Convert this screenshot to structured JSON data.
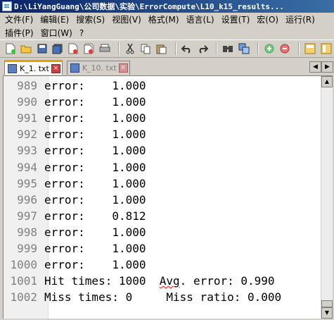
{
  "window": {
    "title": "D:\\LiYangGuang\\公司数据\\实验\\ErrorCompute\\L10_k15_results..."
  },
  "menu": {
    "row1": [
      "文件(F)",
      "编辑(E)",
      "搜索(S)",
      "视图(V)",
      "格式(M)",
      "语言(L)",
      "设置(T)",
      "宏(O)",
      "运行(R)"
    ],
    "row2": [
      "插件(P)",
      "窗口(W)",
      "?"
    ]
  },
  "toolbar": {
    "icons": [
      "new-file-icon",
      "open-file-icon",
      "save-icon",
      "save-all-icon",
      "close-icon",
      "close-all-icon",
      "print-icon",
      "cut-icon",
      "copy-icon",
      "paste-icon",
      "undo-icon",
      "redo-icon",
      "find-icon",
      "replace-icon",
      "zoom-in-icon",
      "zoom-out-icon",
      "sync-vertical-icon",
      "sync-horizontal-icon"
    ]
  },
  "tabs": [
    {
      "label": "K_1. txt",
      "active": true
    },
    {
      "label": "K_10. txt",
      "active": false
    }
  ],
  "editor": {
    "lines": [
      {
        "num": "989",
        "text": "error:    1.000"
      },
      {
        "num": "990",
        "text": "error:    1.000"
      },
      {
        "num": "991",
        "text": "error:    1.000"
      },
      {
        "num": "992",
        "text": "error:    1.000"
      },
      {
        "num": "993",
        "text": "error:    1.000"
      },
      {
        "num": "994",
        "text": "error:    1.000"
      },
      {
        "num": "995",
        "text": "error:    1.000"
      },
      {
        "num": "996",
        "text": "error:    1.000"
      },
      {
        "num": "997",
        "text": "error:    0.812"
      },
      {
        "num": "998",
        "text": "error:    1.000"
      },
      {
        "num": "999",
        "text": "error:    1.000"
      },
      {
        "num": "1000",
        "text": "error:    1.000"
      },
      {
        "num": "1001",
        "text_pre": "Hit times: 1000  ",
        "text_squiggle": "Avg",
        "text_post": ". error: 0.990"
      },
      {
        "num": "1002",
        "text": "Miss times: 0     Miss ratio: 0.000"
      }
    ]
  }
}
